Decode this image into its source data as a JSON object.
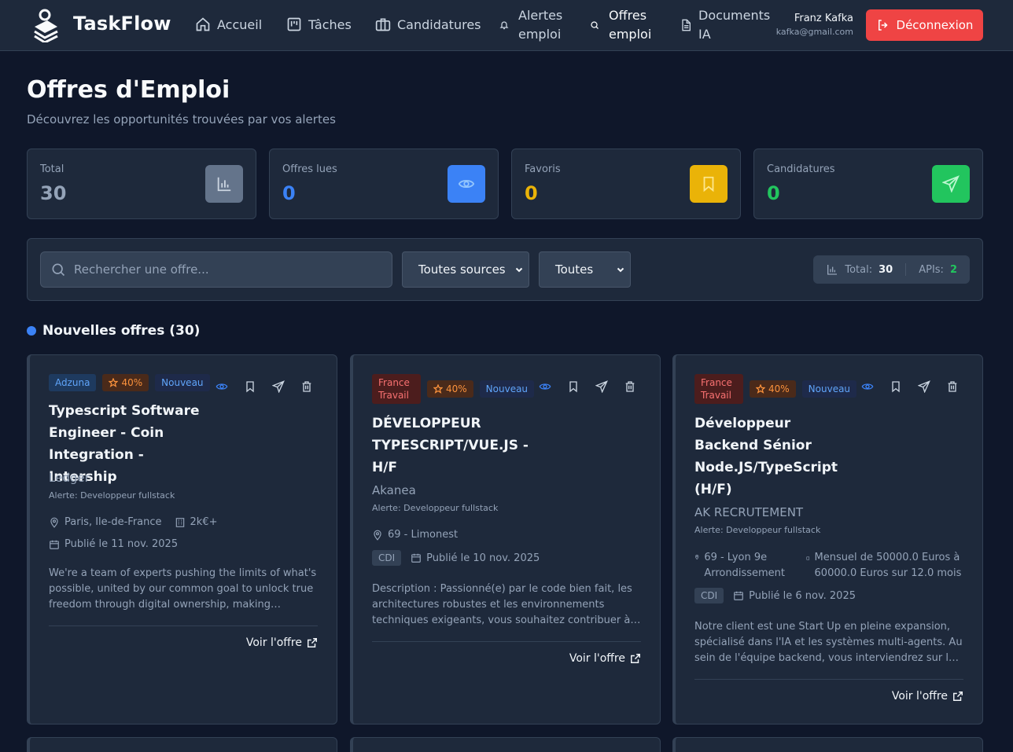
{
  "app": {
    "brand": "TaskFlow"
  },
  "nav": {
    "items": [
      {
        "label": "Accueil",
        "icon": "home-icon"
      },
      {
        "label": "Tâches",
        "icon": "kanban-icon"
      },
      {
        "label": "Candidatures",
        "icon": "briefcase-icon"
      },
      {
        "label1": "Alertes",
        "label2": "emploi",
        "icon": "bell-icon"
      },
      {
        "label1": "Offres",
        "label2": "emploi",
        "icon": "search-icon",
        "active": true
      },
      {
        "label1": "Documents",
        "label2": "IA",
        "icon": "document-icon"
      }
    ],
    "user": {
      "name": "Franz Kafka",
      "email": "kafka@gmail.com"
    },
    "logout_label": "Déconnexion"
  },
  "page": {
    "title": "Offres d'Emploi",
    "subtitle": "Découvrez les opportunités trouvées par vos alertes"
  },
  "stats": [
    {
      "label": "Total",
      "value": "30",
      "color": "#94a3b8",
      "icon_bg": "#64748b",
      "icon": "chart-icon"
    },
    {
      "label": "Offres lues",
      "value": "0",
      "color": "#3b82f6",
      "icon_bg": "#3b82f6",
      "icon": "eye-icon"
    },
    {
      "label": "Favoris",
      "value": "0",
      "color": "#eab308",
      "icon_bg": "#eab308",
      "icon": "bookmark-icon"
    },
    {
      "label": "Candidatures",
      "value": "0",
      "color": "#22c55e",
      "icon_bg": "#22c55e",
      "icon": "send-icon"
    }
  ],
  "filters": {
    "search_placeholder": "Rechercher une offre...",
    "source_selected": "Toutes sources",
    "status_selected": "Toutes",
    "total_label": "Total:",
    "total_value": "30",
    "apis_label": "APIs:",
    "apis_value": "2"
  },
  "section": {
    "title": "Nouvelles offres (30)"
  },
  "jobs": [
    {
      "source": "Adzuna",
      "score": "40%",
      "status": "Nouveau",
      "title": "Typescript Software Engineer - Coin Integration - Intership",
      "company": "Ledger",
      "alert": "Alerte: Developpeur fullstack",
      "location": "Paris, Ile-de-France",
      "salary": "2k€+",
      "date": "Publié le 11 nov. 2025",
      "description": "We're a team of experts pushing the limits of what's possible, united by our common goal to unlock true freedom through digital ownership, making technology accessible to everyone.",
      "link_label": "Voir l'offre"
    },
    {
      "source": "France Travail",
      "score": "40%",
      "status": "Nouveau",
      "title": "DÉVELOPPEUR TYPESCRIPT/VUE.JS - H/F",
      "company": "Akanea",
      "alert": "Alerte: Developpeur fullstack",
      "location": "69 - Limonest",
      "contract": "CDI",
      "date": "Publié le 10 nov. 2025",
      "description": "Description : Passionné(e) par le code bien fait, les architectures robustes et les environnements techniques exigeants, vous souhaitez contribuer à la conception de nos solutions.",
      "link_label": "Voir l'offre"
    },
    {
      "source": "France Travail",
      "score": "40%",
      "status": "Nouveau",
      "title": "Développeur Backend Sénior Node.JS/TypeScript (H/F)",
      "company": "AK RECRUTEMENT",
      "alert": "Alerte: Developpeur fullstack",
      "location": "69 - Lyon 9e Arrondissement",
      "salary": "Mensuel de 50000.0 Euros à 60000.0 Euros sur 12.0 mois",
      "contract": "CDI",
      "date": "Publié le 6 nov. 2025",
      "description": "Notre client est une Start Up en pleine expansion, spécialisé dans l'IA et les systèmes multi-agents. Au sein de l'équipe backend, vous interviendrez sur le développement de la plateforme.",
      "link_label": "Voir l'offre"
    }
  ]
}
